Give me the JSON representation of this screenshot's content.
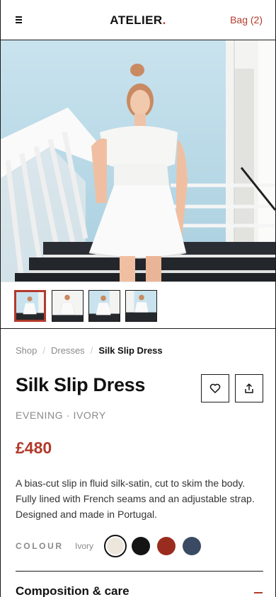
{
  "header": {
    "brand": "ATELIER",
    "brand_dot": ".",
    "bag_label": "Bag (2)"
  },
  "icons": {
    "menu": "hamburger-icon",
    "favorite": "heart-icon",
    "share": "share-icon",
    "collapse": "minus-icon"
  },
  "colors": {
    "accent": "#b23a2b",
    "text": "#111111",
    "muted": "#8a8a8a"
  },
  "gallery": {
    "thumbnail_count": 4,
    "active_index": 0
  },
  "breadcrumb": {
    "items": [
      "Shop",
      "Dresses",
      "Silk Slip Dress"
    ]
  },
  "product": {
    "title": "Silk Slip Dress",
    "subtitle": "EVENING · IVORY",
    "price": "£480",
    "description": "A bias-cut slip in fluid silk-satin, cut to skim the body. Fully lined with French seams and an adjustable strap. Designed and made in Portugal."
  },
  "colour": {
    "label": "COLOUR",
    "selected": "Ivory",
    "swatches": [
      "#ece6dc",
      "#141414",
      "#9a2c1f",
      "#3b4a63"
    ]
  },
  "sections": {
    "composition_title": "Composition & care"
  }
}
